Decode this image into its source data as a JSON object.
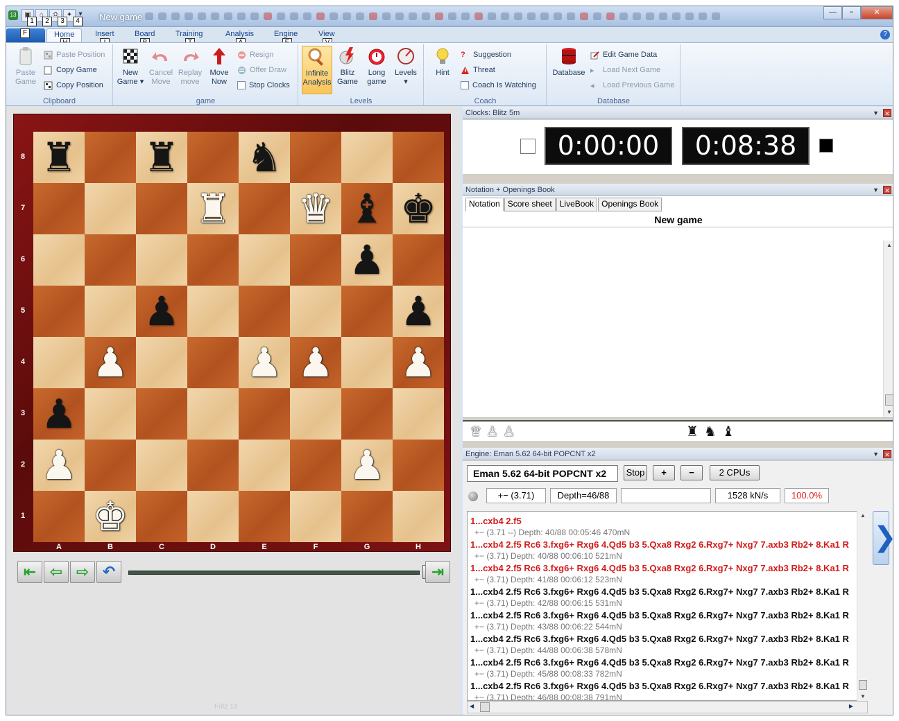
{
  "window": {
    "title": "New game",
    "app_badge": "13",
    "controls": {
      "minimize": "—",
      "maximize": "▫",
      "close": "✕"
    }
  },
  "qat_keytips": [
    "1",
    "2",
    "3",
    "4"
  ],
  "ribbon": {
    "file_keytip": "F",
    "tabs": [
      {
        "label": "Home",
        "keytip": "H"
      },
      {
        "label": "Insert",
        "keytip": "I"
      },
      {
        "label": "Board",
        "keytip": "B"
      },
      {
        "label": "Training",
        "keytip": "T"
      },
      {
        "label": "Analysis",
        "keytip": "A"
      },
      {
        "label": "Engine",
        "keytip": "E"
      },
      {
        "label": "View",
        "keytip": "V"
      }
    ],
    "help": "?",
    "groups": {
      "clipboard": {
        "label": "Clipboard",
        "paste_game": "Paste Game",
        "paste_position": "Paste Position",
        "copy_game": "Copy Game",
        "copy_position": "Copy Position"
      },
      "game": {
        "label": "game",
        "new_game": "New Game",
        "cancel_move": "Cancel Move",
        "replay_move": "Replay move",
        "move_now": "Move Now",
        "resign": "Resign",
        "offer_draw": "Offer Draw",
        "stop_clocks": "Stop Clocks"
      },
      "levels": {
        "label": "Levels",
        "infinite_analysis": "Infinite Analysis",
        "blitz_game": "Blitz Game",
        "long_game": "Long game",
        "levels": "Levels"
      },
      "coach": {
        "label": "Coach",
        "hint": "Hint",
        "suggestion": "Suggestion",
        "threat": "Threat",
        "coach_is_watching": "Coach Is Watching"
      },
      "database": {
        "label": "Database",
        "database": "Database",
        "edit_game_data": "Edit Game Data",
        "load_next_game": "Load Next Game",
        "load_previous_game": "Load Previous Game"
      }
    }
  },
  "board": {
    "ranks": [
      "8",
      "7",
      "6",
      "5",
      "4",
      "3",
      "2",
      "1"
    ],
    "files": [
      "A",
      "B",
      "C",
      "D",
      "E",
      "F",
      "G",
      "H"
    ],
    "position": [
      [
        "r",
        "",
        "r",
        "",
        "n",
        "",
        "",
        ""
      ],
      [
        "",
        "",
        "",
        "R",
        "",
        "Q",
        "b",
        "k"
      ],
      [
        "",
        "",
        "",
        "",
        "",
        "",
        "p",
        ""
      ],
      [
        "",
        "",
        "p",
        "",
        "",
        "",
        "",
        "p"
      ],
      [
        "",
        "P",
        "",
        "",
        "P",
        "P",
        "",
        "P"
      ],
      [
        "p",
        "",
        "",
        "",
        "",
        "",
        "",
        ""
      ],
      [
        "P",
        "",
        "",
        "",
        "",
        "",
        "P",
        ""
      ],
      [
        "",
        "K",
        "",
        "",
        "",
        "",
        "",
        ""
      ]
    ],
    "watermark": "Fritz 13"
  },
  "clocks": {
    "header": "Clocks: Blitz 5m",
    "white_time": "0:00:00",
    "black_time": "0:08:38"
  },
  "notation": {
    "header": "Notation + Openings Book",
    "tabs": [
      "Notation",
      "Score sheet",
      "LiveBook",
      "Openings Book"
    ],
    "active_tab": "Notation",
    "game_title": "New game"
  },
  "captured": {
    "white": "♛♙♙",
    "black": "♜♞♝"
  },
  "engine": {
    "header": "Engine: Eman 5.62 64-bit POPCNT x2",
    "name": "Eman 5.62 64-bit POPCNT x2",
    "stop": "Stop",
    "plus": "+",
    "minus": "−",
    "cpus": "2 CPUs",
    "eval": "+− (3.71)",
    "depth": "Depth=46/88",
    "empty_box": "",
    "speed": "1528 kN/s",
    "load": "100.0%",
    "lines": [
      {
        "text": "1...cxb4 2.f5",
        "style": "red"
      },
      {
        "text": "+− (3.71 --)  Depth: 40/88   00:05:46  470mN",
        "style": "sub"
      },
      {
        "text": "1...cxb4 2.f5 Rc6 3.fxg6+ Rxg6 4.Qd5 b3 5.Qxa8 Rxg2 6.Rxg7+ Nxg7 7.axb3 Rb2+ 8.Ka1 R",
        "style": "red"
      },
      {
        "text": "+− (3.71)   Depth: 40/88   00:06:10  521mN",
        "style": "sub"
      },
      {
        "text": "1...cxb4 2.f5 Rc6 3.fxg6+ Rxg6 4.Qd5 b3 5.Qxa8 Rxg2 6.Rxg7+ Nxg7 7.axb3 Rb2+ 8.Ka1 R",
        "style": "red"
      },
      {
        "text": "+− (3.71)   Depth: 41/88   00:06:12  523mN",
        "style": "sub"
      },
      {
        "text": "1...cxb4 2.f5 Rc6 3.fxg6+ Rxg6 4.Qd5 b3 5.Qxa8 Rxg2 6.Rxg7+ Nxg7 7.axb3 Rb2+ 8.Ka1 R",
        "style": "main"
      },
      {
        "text": "+− (3.71)   Depth: 42/88   00:06:15  531mN",
        "style": "sub"
      },
      {
        "text": "1...cxb4 2.f5 Rc6 3.fxg6+ Rxg6 4.Qd5 b3 5.Qxa8 Rxg2 6.Rxg7+ Nxg7 7.axb3 Rb2+ 8.Ka1 R",
        "style": "main"
      },
      {
        "text": "+− (3.71)   Depth: 43/88   00:06:22  544mN",
        "style": "sub"
      },
      {
        "text": "1...cxb4 2.f5 Rc6 3.fxg6+ Rxg6 4.Qd5 b3 5.Qxa8 Rxg2 6.Rxg7+ Nxg7 7.axb3 Rb2+ 8.Ka1 R",
        "style": "main"
      },
      {
        "text": "+− (3.71)   Depth: 44/88   00:06:38  578mN",
        "style": "sub"
      },
      {
        "text": "1...cxb4 2.f5 Rc6 3.fxg6+ Rxg6 4.Qd5 b3 5.Qxa8 Rxg2 6.Rxg7+ Nxg7 7.axb3 Rb2+ 8.Ka1 R",
        "style": "main"
      },
      {
        "text": "+− (3.71)   Depth: 45/88   00:08:33  782mN",
        "style": "sub"
      },
      {
        "text": "1...cxb4 2.f5 Rc6 3.fxg6+ Rxg6 4.Qd5 b3 5.Qxa8 Rxg2 6.Rxg7+ Nxg7 7.axb3 Rb2+ 8.Ka1 R",
        "style": "main"
      },
      {
        "text": "+− (3.71)   Depth: 46/88   00:08:38  791mN",
        "style": "sub"
      }
    ]
  },
  "icons": {
    "board_next": "❯"
  }
}
